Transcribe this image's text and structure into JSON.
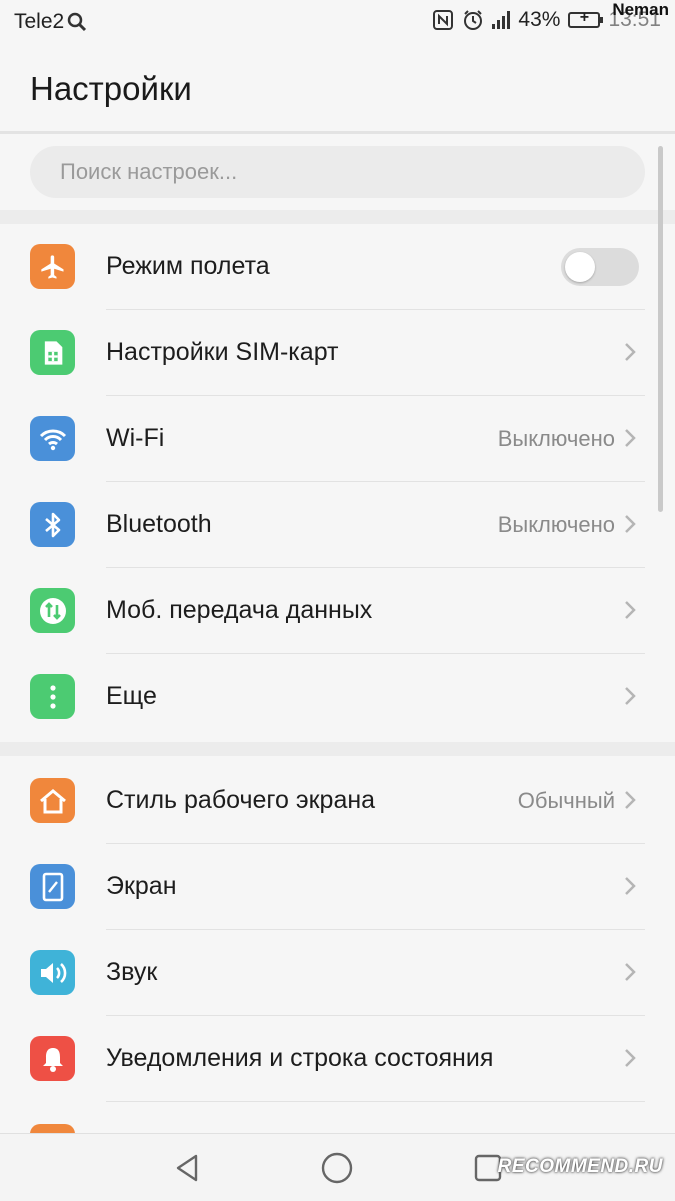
{
  "status_bar": {
    "carrier": "Tele2",
    "battery_percent": "43%",
    "time": "13:51",
    "overlay_user": "Neman"
  },
  "header": {
    "title": "Настройки"
  },
  "search": {
    "placeholder": "Поиск настроек..."
  },
  "sections": [
    {
      "items": [
        {
          "label": "Режим полета",
          "icon": "airplane-icon",
          "icon_color": "#f0873c",
          "control": "toggle",
          "toggle_on": false
        },
        {
          "label": "Настройки SIM-карт",
          "icon": "sim-card-icon",
          "icon_color": "#4ccb72"
        },
        {
          "label": "Wi-Fi",
          "icon": "wifi-icon",
          "icon_color": "#4a90d9",
          "value": "Выключено"
        },
        {
          "label": "Bluetooth",
          "icon": "bluetooth-icon",
          "icon_color": "#4a90d9",
          "value": "Выключено"
        },
        {
          "label": "Моб. передача данных",
          "icon": "mobile-data-icon",
          "icon_color": "#4ccb72"
        },
        {
          "label": "Еще",
          "icon": "more-icon",
          "icon_color": "#4ccb72"
        }
      ]
    },
    {
      "items": [
        {
          "label": "Стиль рабочего экрана",
          "icon": "home-icon",
          "icon_color": "#f0873c",
          "value": "Обычный"
        },
        {
          "label": "Экран",
          "icon": "display-icon",
          "icon_color": "#4a90d9"
        },
        {
          "label": "Звук",
          "icon": "sound-icon",
          "icon_color": "#3fb3d8"
        },
        {
          "label": "Уведомления и строка состояния",
          "icon": "bell-icon",
          "icon_color": "#ee5045"
        }
      ]
    }
  ],
  "nav": {
    "back": "back-icon",
    "home": "home-circle-icon",
    "recents": "recents-icon"
  },
  "watermark": "RECOMMEND.RU"
}
